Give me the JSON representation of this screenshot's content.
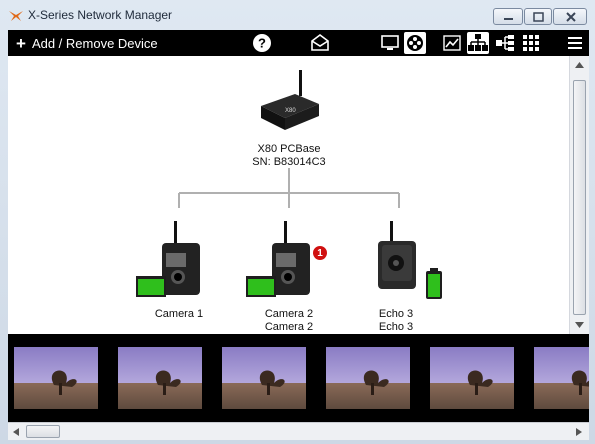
{
  "window": {
    "title": "X-Series Network Manager"
  },
  "toolbar": {
    "add_label": "Add / Remove Device",
    "icons": [
      "help-icon",
      "message-icon",
      "monitor-icon",
      "film-reel-icon",
      "chart-icon",
      "network-tree-icon",
      "hierarchy-icon",
      "grid-view-icon",
      "menu-icon"
    ]
  },
  "base": {
    "name": "X80 PCBase",
    "sn": "SN: B83014C3"
  },
  "devices": [
    {
      "line1": "Camera 1",
      "line2": "",
      "badge": "",
      "battery": "green"
    },
    {
      "line1": "Camera 2",
      "line2": "Camera 2",
      "badge": "1",
      "battery": "green"
    },
    {
      "line1": "Echo 3",
      "line2": "Echo 3",
      "badge": "",
      "battery": "green"
    }
  ],
  "colors": {
    "badge": "#d01010",
    "battery": "#2fbf1c",
    "toolbar": "#000000"
  },
  "thumbnail_count": 6
}
